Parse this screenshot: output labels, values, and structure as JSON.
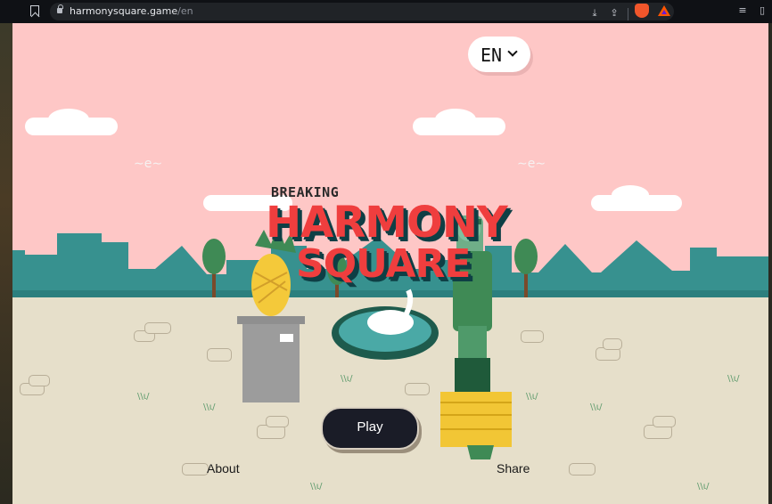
{
  "browser": {
    "url_host": "harmonysquare.game",
    "url_path": "/en"
  },
  "language_selector": {
    "label": "EN"
  },
  "title": {
    "line1": "BREAKING",
    "line2": "HARMONY",
    "line3": "SQUARE"
  },
  "buttons": {
    "play": "Play"
  },
  "footer_links": {
    "about": "About",
    "share": "Share"
  },
  "colors": {
    "sky": "#fec7c6",
    "ground": "#e6dfca",
    "hills": "#37918f",
    "title_red": "#ef3e3e",
    "play_button": "#1a1c27"
  },
  "icons": [
    "bookmark-icon",
    "lock-icon",
    "download-icon",
    "share-icon",
    "brave-shield-icon",
    "bat-rewards-icon",
    "reading-list-icon",
    "sidebar-icon",
    "chevron-down-icon"
  ]
}
